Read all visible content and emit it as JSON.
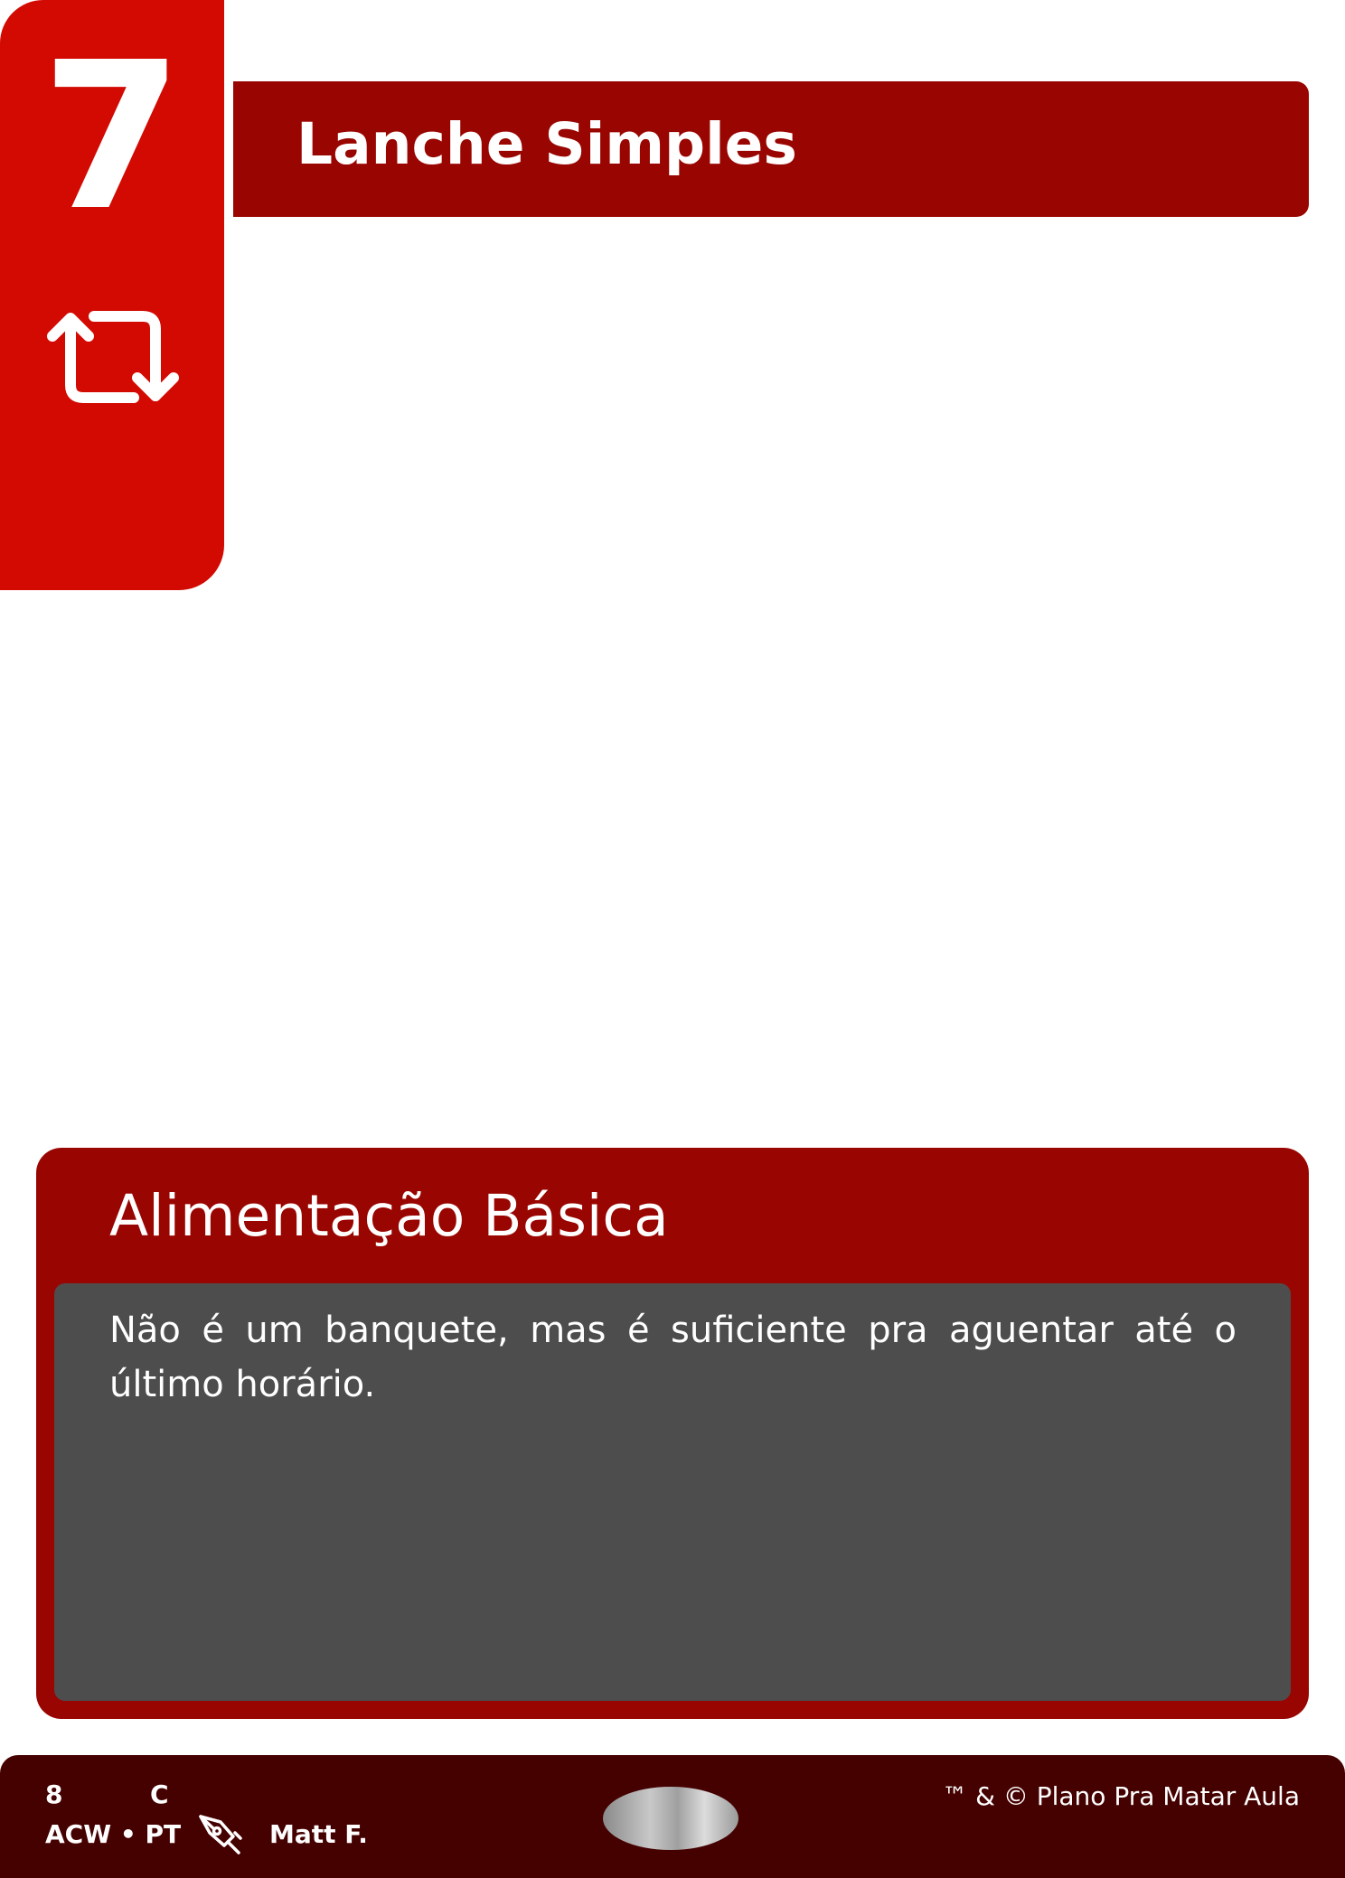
{
  "card": {
    "cost": "7",
    "title": "Lanche Simples",
    "type_line": "Alimentação Básica",
    "text": "Não é um banquete, mas é suficiente pra aguentar até o último horário."
  },
  "footer": {
    "number": "8",
    "rarity": "C",
    "set_lang": "ACW • PT",
    "artist": "Matt F.",
    "copyright": "™ & © Plano Pra Matar Aula"
  },
  "icons": {
    "cost_tab": "repeat-icon",
    "artist": "pen-nib-icon",
    "stamp": "holo-stamp"
  },
  "colors": {
    "cost_tab": "#d20a02",
    "title_bar": "#990500",
    "text_panel": "#990500",
    "text_box": "#4d4d4d",
    "footer": "#450000"
  }
}
